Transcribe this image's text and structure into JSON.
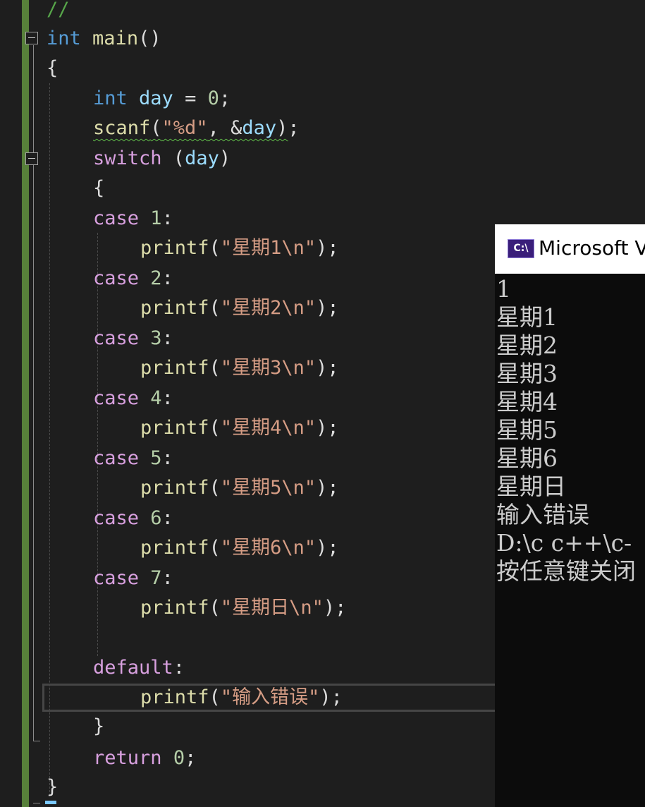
{
  "editor": {
    "lines": [
      {
        "id": "comment",
        "text": "//"
      },
      {
        "id": "main-decl",
        "kw": "int",
        "fn": "main",
        "rest": "()"
      },
      {
        "id": "open-brace-main",
        "text": "{"
      },
      {
        "id": "day-decl",
        "kw": "int",
        "var": "day",
        "op": " = ",
        "num": "0",
        "end": ";"
      },
      {
        "id": "scanf-call",
        "fn": "scanf",
        "p1": "(",
        "str": "\"%d\"",
        "p2": ", &",
        "var": "day",
        "p3": ")",
        "end": ";"
      },
      {
        "id": "switch-stmt",
        "ctl": "switch",
        "p1": " (",
        "var": "day",
        "p2": ")"
      },
      {
        "id": "open-brace-switch",
        "text": "{"
      },
      {
        "id": "case-1",
        "ctl": "case",
        "num": "1",
        "colon": ":"
      },
      {
        "id": "printf-1",
        "fn": "printf",
        "p1": "(",
        "str": "\"星期1\\n\"",
        "p2": ");"
      },
      {
        "id": "case-2",
        "ctl": "case",
        "num": "2",
        "colon": ":"
      },
      {
        "id": "printf-2",
        "fn": "printf",
        "p1": "(",
        "str": "\"星期2\\n\"",
        "p2": ");"
      },
      {
        "id": "case-3",
        "ctl": "case",
        "num": "3",
        "colon": ":"
      },
      {
        "id": "printf-3",
        "fn": "printf",
        "p1": "(",
        "str": "\"星期3\\n\"",
        "p2": ");"
      },
      {
        "id": "case-4",
        "ctl": "case",
        "num": "4",
        "colon": ":"
      },
      {
        "id": "printf-4",
        "fn": "printf",
        "p1": "(",
        "str": "\"星期4\\n\"",
        "p2": ");"
      },
      {
        "id": "case-5",
        "ctl": "case",
        "num": "5",
        "colon": ":"
      },
      {
        "id": "printf-5",
        "fn": "printf",
        "p1": "(",
        "str": "\"星期5\\n\"",
        "p2": ");"
      },
      {
        "id": "case-6",
        "ctl": "case",
        "num": "6",
        "colon": ":"
      },
      {
        "id": "printf-6",
        "fn": "printf",
        "p1": "(",
        "str": "\"星期6\\n\"",
        "p2": ");"
      },
      {
        "id": "case-7",
        "ctl": "case",
        "num": "7",
        "colon": ":"
      },
      {
        "id": "printf-7",
        "fn": "printf",
        "p1": "(",
        "str": "\"星期日\\n\"",
        "p2": ");"
      },
      {
        "id": "default",
        "ctl": "default",
        "colon": ":"
      },
      {
        "id": "printf-default",
        "fn": "printf",
        "p1": "(",
        "str": "\"输入错误\"",
        "p2": ");"
      },
      {
        "id": "close-brace-switch",
        "text": "}"
      },
      {
        "id": "return-stmt",
        "ctl": "return",
        "num": "0",
        "end": ";"
      },
      {
        "id": "close-brace-main",
        "text": "}"
      }
    ]
  },
  "console": {
    "title": "Microsoft V",
    "icon_text": "C:\\",
    "output": [
      "1",
      "星期1",
      "星期2",
      "星期3",
      "星期4",
      "星期5",
      "星期6",
      "星期日",
      "输入错误",
      "D:\\c c++\\c-",
      "按任意键关闭"
    ]
  },
  "colors": {
    "background": "#1e1e1e",
    "keyword": "#569cd6",
    "control": "#d8a0df",
    "function": "#dcdcaa",
    "string": "#d69d85",
    "number": "#b5cea8",
    "variable": "#9cdcfe",
    "comment": "#57a64a",
    "change_bar": "#57803a"
  }
}
